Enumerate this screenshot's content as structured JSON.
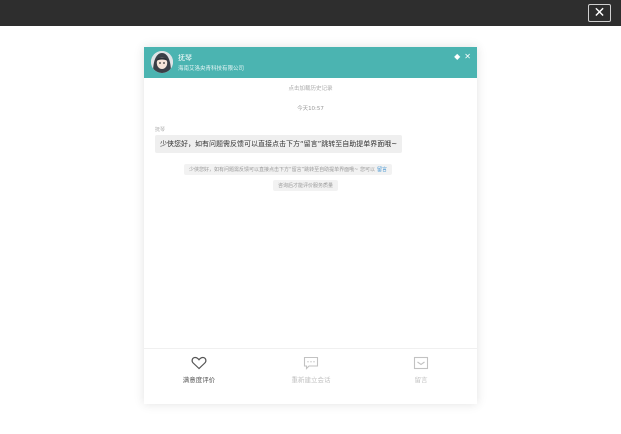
{
  "overlay": {
    "close_glyph": "✕"
  },
  "header": {
    "agent_name": "抚琴",
    "company": "海南艾洛央青科技有限公司",
    "icons": [
      "pin-icon",
      "close-icon"
    ],
    "bg_color": "#4bb4b1"
  },
  "chat": {
    "history_link": "点击加载历史记录",
    "timestamp": "今天10:57",
    "sender": "抚琴",
    "message": "少侠您好，如有问题需反馈可以直接点击下方“留言”跳转至自助提单界面哦~",
    "notice_text": "少侠您好，如有问题需反馈可以直接点击下方“留言”跳转至自助提单界面哦~ 您可以",
    "notice_link": "留言",
    "rating_notice": "咨询后才能评价服务质量"
  },
  "footer": {
    "items": [
      {
        "label": "满意度评价",
        "icon": "heart-icon",
        "enabled": true
      },
      {
        "label": "重新建立会话",
        "icon": "chat-bubble-icon",
        "enabled": false
      },
      {
        "label": "留言",
        "icon": "message-icon",
        "enabled": false
      }
    ],
    "enabled_color": "#555555",
    "disabled_color": "#c2c2c2"
  }
}
